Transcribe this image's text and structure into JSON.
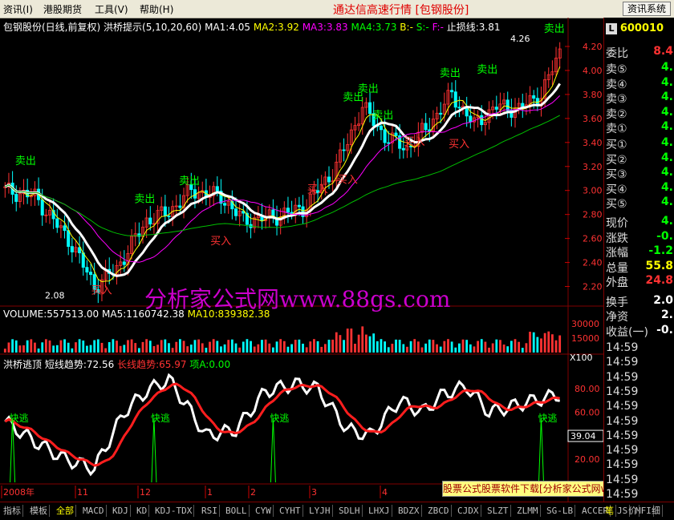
{
  "menu": {
    "items": [
      {
        "label": "资讯(I)"
      },
      {
        "label": "港股期货"
      },
      {
        "label": "工具(V)"
      },
      {
        "label": "帮助(H)"
      }
    ],
    "title": "通达信高速行情 [包钢股份]",
    "system_button": "资讯系统"
  },
  "main_header": {
    "stock": "包钢股份(日线,前复权)",
    "indicator": "洪桥提示(5,10,20,60)",
    "ma1": "MA1:4.05",
    "ma2": "MA2:3.92",
    "ma3": "MA3:3.83",
    "ma4": "MA4:3.73",
    "b": "B:-",
    "s": "S:-",
    "f": "F:-",
    "stop": "止损线:3.81"
  },
  "price_axis": [
    "4.20",
    "4.00",
    "3.80",
    "3.60",
    "3.40",
    "3.20",
    "3.00",
    "2.80",
    "2.60",
    "2.40",
    "2.20"
  ],
  "annotations": {
    "high": "4.26",
    "low": "2.08",
    "sell": "卖出",
    "buy": "买入"
  },
  "volume_header": {
    "volume": "VOLUME:557513.00",
    "ma5": "MA5:1160742.38",
    "ma10": "MA10:839382.38"
  },
  "volume_axis": {
    "top": "30000",
    "mid": "15000",
    "unit": "X100"
  },
  "osc_header": {
    "name": "洪桥逃顶",
    "short": "短线趋势:72.56",
    "long": "长线趋势:65.97",
    "item": "项A:0.00"
  },
  "osc_axis": [
    "80.00",
    "60.00",
    "40.00",
    "20.00"
  ],
  "osc_current": "39.04",
  "osc_label": "快逃",
  "date_axis": [
    "2008年",
    "11",
    "12",
    "1",
    "2",
    "3",
    "4"
  ],
  "watermark": "分析家公式网www.88gs.com",
  "ad": "股票公式股票软件下载[分析家公式网www.88gs.com]",
  "quote": {
    "code": "600010",
    "weibi_label": "委比",
    "weibi_val": "8.4",
    "sells": [
      {
        "label": "卖⑤",
        "val": "4."
      },
      {
        "label": "卖④",
        "val": "4."
      },
      {
        "label": "卖③",
        "val": "4."
      },
      {
        "label": "卖②",
        "val": "4."
      },
      {
        "label": "卖①",
        "val": "4."
      }
    ],
    "buys": [
      {
        "label": "买①",
        "val": "4."
      },
      {
        "label": "买②",
        "val": "4."
      },
      {
        "label": "买③",
        "val": "4."
      },
      {
        "label": "买④",
        "val": "4."
      },
      {
        "label": "买⑤",
        "val": "4."
      }
    ],
    "stats": [
      {
        "label": "现价",
        "val": "4."
      },
      {
        "label": "涨跌",
        "val": "-0."
      },
      {
        "label": "涨幅",
        "val": "-1.2"
      },
      {
        "label": "总量",
        "val": "55.8"
      },
      {
        "label": "外盘",
        "val": "24.8"
      },
      {
        "label": "换手",
        "val": "2.0"
      },
      {
        "label": "净资",
        "val": "2."
      },
      {
        "label": "收益(一)",
        "val": "-0."
      }
    ],
    "times": [
      "14:59",
      "14:59",
      "14:59",
      "14:59",
      "14:59",
      "14:59",
      "14:59",
      "14:59",
      "14:59",
      "14:59",
      "14:59"
    ]
  },
  "tabs": [
    "指标",
    "模板",
    "全部",
    "MACD",
    "KDJ",
    "KD",
    "KDJ-TDX",
    "RSI",
    "BOLL",
    "CYW",
    "CYHT",
    "LYJH",
    "SDLH",
    "LHXJ",
    "BDZX",
    "ZBCD",
    "CJDX",
    "SLZT",
    "ZLMM",
    "SG-LB",
    "ACCER",
    "JS",
    "MFI"
  ],
  "bottom_right": [
    "笔",
    "价",
    "细"
  ],
  "colors": {
    "up": "#ff3232",
    "down": "#00ffff",
    "ma1": "#ffffff",
    "ma2": "#ffff00",
    "ma3": "#ff00ff",
    "ma4": "#00c000",
    "grid": "#800000"
  }
}
